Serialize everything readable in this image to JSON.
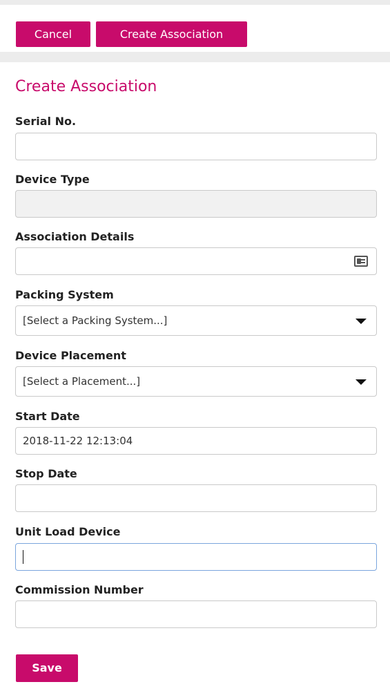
{
  "toolbar": {
    "cancel_label": "Cancel",
    "create_label": "Create Association"
  },
  "page": {
    "title": "Create Association"
  },
  "form": {
    "serial_no": {
      "label": "Serial No.",
      "value": ""
    },
    "device_type": {
      "label": "Device Type",
      "value": ""
    },
    "association_details": {
      "label": "Association Details",
      "value": "",
      "icon": "id-card-icon"
    },
    "packing_system": {
      "label": "Packing System",
      "selected": "[Select a Packing System...]"
    },
    "device_placement": {
      "label": "Device Placement",
      "selected": "[Select a Placement...]"
    },
    "start_date": {
      "label": "Start Date",
      "value": "2018-11-22 12:13:04"
    },
    "stop_date": {
      "label": "Stop Date",
      "value": ""
    },
    "unit_load_device": {
      "label": "Unit Load Device",
      "value": ""
    },
    "commission_number": {
      "label": "Commission Number",
      "value": ""
    },
    "save_label": "Save"
  },
  "colors": {
    "accent": "#c80b6b",
    "focus_border": "#7aa5dd",
    "disabled_bg": "#f1f1f1"
  }
}
